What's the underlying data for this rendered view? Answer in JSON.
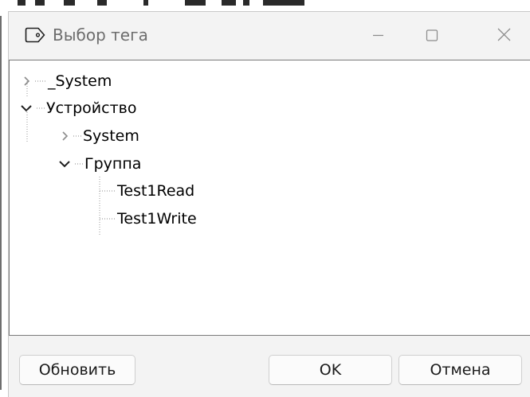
{
  "window": {
    "title": "Выбор тега",
    "title_icon": "tag-icon",
    "controls": [
      "minimize-icon",
      "maximize-icon",
      "close-icon"
    ]
  },
  "tree": {
    "nodes": [
      {
        "label": "_System",
        "level": 0,
        "expander": "collapsed"
      },
      {
        "label": "Устройство",
        "level": 0,
        "expander": "expanded"
      },
      {
        "label": "System",
        "level": 1,
        "expander": "collapsed"
      },
      {
        "label": "Группа",
        "level": 1,
        "expander": "expanded"
      },
      {
        "label": "Test1Read",
        "level": 2,
        "expander": "leaf"
      },
      {
        "label": "Test1Write",
        "level": 2,
        "expander": "leaf"
      }
    ]
  },
  "buttons": {
    "refresh": "Обновить",
    "ok": "OK",
    "cancel": "Отмена"
  }
}
